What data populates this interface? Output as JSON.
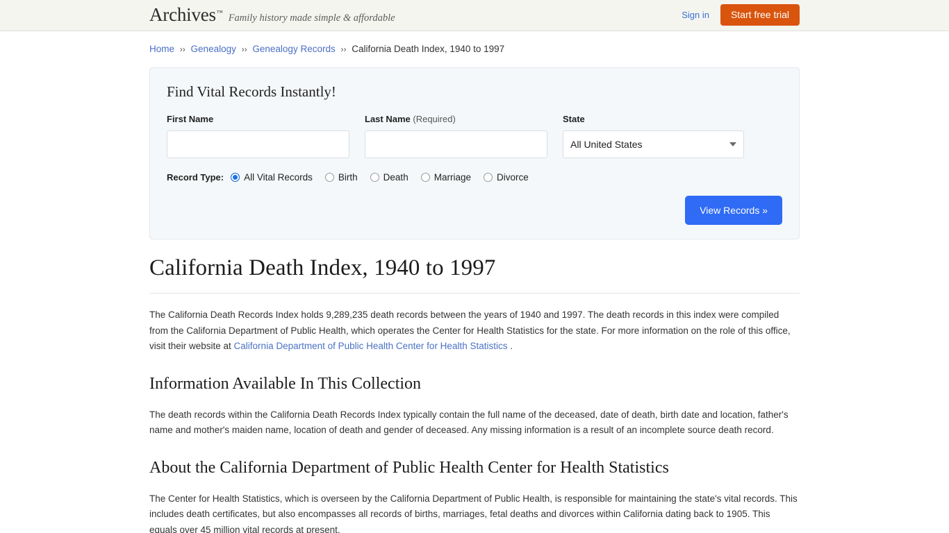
{
  "header": {
    "brand_name": "Archives",
    "brand_tm": "™",
    "tagline": "Family history made simple & affordable",
    "signin_label": "Sign in",
    "trial_label": "Start free trial",
    "accent_orange": "#d9540d",
    "link_blue": "#3b6fd4"
  },
  "breadcrumb": {
    "separator": "››",
    "items": [
      {
        "label": "Home",
        "link": true
      },
      {
        "label": "Genealogy",
        "link": true
      },
      {
        "label": "Genealogy Records",
        "link": true
      },
      {
        "label": "California Death Index, 1940 to 1997",
        "link": false
      }
    ]
  },
  "search_panel": {
    "title": "Find Vital Records Instantly!",
    "first_name": {
      "label": "First Name",
      "value": "",
      "placeholder": ""
    },
    "last_name": {
      "label": "Last Name",
      "required_note": "(Required)",
      "value": "",
      "placeholder": ""
    },
    "state": {
      "label": "State",
      "selected": "All United States",
      "options": [
        "All United States"
      ]
    },
    "record_type": {
      "label": "Record Type:",
      "options": [
        {
          "label": "All Vital Records",
          "selected": true
        },
        {
          "label": "Birth",
          "selected": false
        },
        {
          "label": "Death",
          "selected": false
        },
        {
          "label": "Marriage",
          "selected": false
        },
        {
          "label": "Divorce",
          "selected": false
        }
      ]
    },
    "submit_label": "View Records »",
    "submit_color": "#2f6bf5"
  },
  "article": {
    "title": "California Death Index, 1940 to 1997",
    "intro_part1": "The California Death Records Index holds 9,289,235 death records between the years of 1940 and 1997. The death records in this index were compiled from the California Department of Public Health, which operates the Center for Health Statistics for the state. For more information on the role of this office, visit their website at ",
    "intro_link": "California Department of Public Health Center for Health Statistics",
    "intro_part2": " .",
    "sections": [
      {
        "heading": "Information Available In This Collection",
        "text": "The death records within the California Death Records Index typically contain the full name of the deceased, date of death, birth date and location, father's name and mother's maiden name, location of death and gender of deceased. Any missing information is a result of an incomplete source death record."
      },
      {
        "heading": "About the California Department of Public Health Center for Health Statistics",
        "text": "The Center for Health Statistics, which is overseen by the California Department of Public Health, is responsible for maintaining the state's vital records. This includes death certificates, but also encompasses all records of births, marriages, fetal deaths and divorces within California dating back to 1905. This equals over 45 million vital records at present."
      }
    ]
  }
}
